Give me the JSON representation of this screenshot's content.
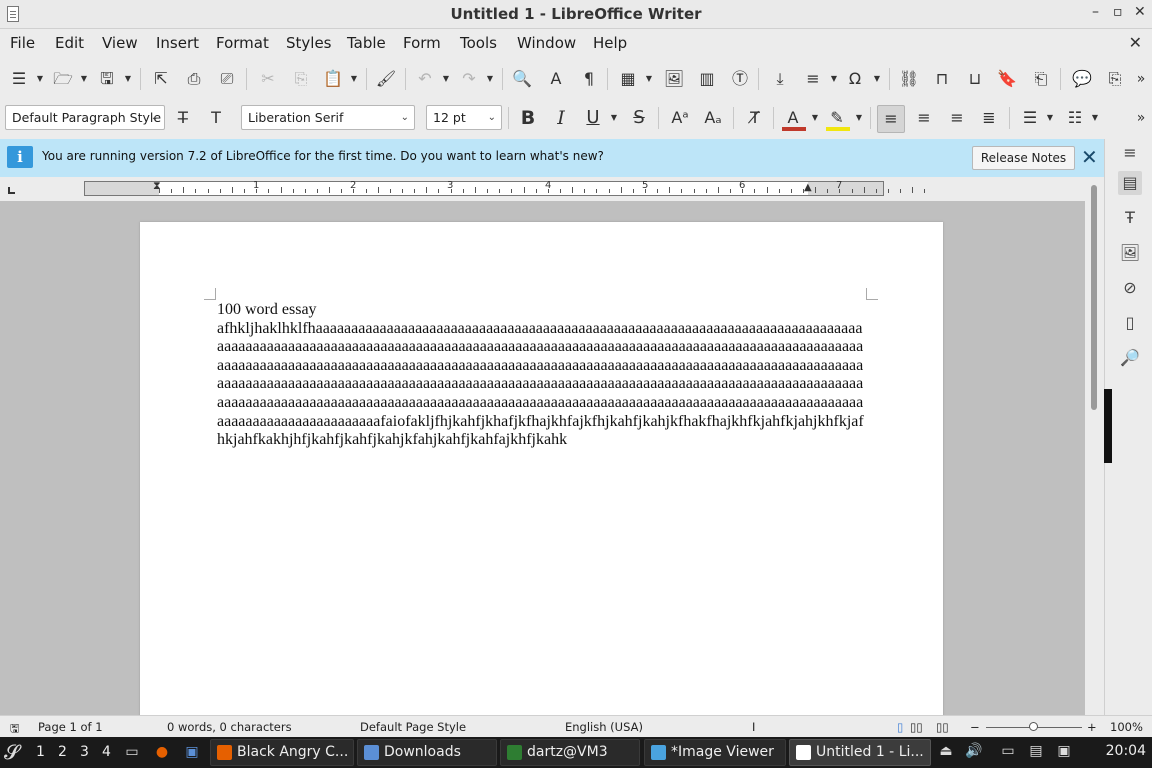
{
  "window": {
    "title": "Untitled 1 - LibreOffice Writer",
    "min_glyph": "–",
    "max_glyph": "▫",
    "close_glyph": "✕"
  },
  "menubar": {
    "items": [
      "File",
      "Edit",
      "View",
      "Insert",
      "Format",
      "Styles",
      "Table",
      "Form",
      "Tools",
      "Window",
      "Help"
    ],
    "close_glyph": "✕"
  },
  "formatting": {
    "paragraph_style": "Default Paragraph Style",
    "font_name": "Liberation Serif",
    "font_size": "12 pt",
    "bold_glyph": "B",
    "italic_glyph": "I",
    "underline_glyph": "U",
    "strike_glyph": "S",
    "font_color": "#c0392b",
    "highlight_color": "#f1e60f"
  },
  "infobar": {
    "message": "You are running version 7.2 of LibreOffice for the first time. Do you want to learn what's new?",
    "button_label": "Release Notes",
    "icon_glyph": "i",
    "close_glyph": "✕"
  },
  "ruler": {
    "numbers": [
      "1",
      "2",
      "3",
      "4",
      "5",
      "6",
      "7"
    ]
  },
  "document": {
    "line1": "100 word essay",
    "body": "afhkljhaklhklfhaaaaaaaaaaaaaaaaaaaaaaaaaaaaaaaaaaaaaaaaaaaaaaaaaaaaaaaaaaaaaaaaaaaaaaaaaaaaaaaaaaaaaaaaaaaaaaaaaaaaaaaaaaaaaaaaaaaaaaaaaaaaaaaaaaaaaaaaaaaaaaaaaaaaaaaaaaaaaaaaaaaaaaaaaaaaaaaaaaaaaaaaaaaaaaaaaaaaaaaaaaaaaaaaaaaaaaaaaaaaaaaaaaaaaaaaaaaaaaaaaaaaaaaaaaaaaaaaaaaaaaaaaaaaaaaaaaaaaaaaaaaaaaaaaaaaaaaaaaaaaaaaaaaaaaaaaaaaaaaaaaaaaaaaaaaaaaaaaaaaaaaaaaaaaaaaaaaaaaaaaaaaaaaaaaaaaaaaaaaaaaaaaaaaaaaaaaaaaaaaaaaaaaaaaaaaaaaaaaaaaaaaaaaaaaaaaaaaaaaaaaaaaaaaaaaaaaaaaaaaaaaafaiofakljfhjkahfjkhafjkfhajkhfajkfhjkahfjkahjkfhakfhajkhfkjahfkjahjkhfkjafhkjahfkakhjhfjkahfjkahfjkahjkfahjkahfjkahfajkhfjkahk"
  },
  "statusbar": {
    "page": "Page 1 of 1",
    "words": "0 words, 0 characters",
    "page_style": "Default Page Style",
    "language": "English (USA)",
    "zoom": "100%",
    "zoom_minus": "−",
    "zoom_plus": "+"
  },
  "taskbar": {
    "workspaces": [
      "1",
      "2",
      "3",
      "4"
    ],
    "tasks": [
      {
        "label": "Black Angry C...",
        "icon_color": "#e66000"
      },
      {
        "label": "Downloads",
        "icon_color": "#5b8fd6"
      },
      {
        "label": "dartz@VM3",
        "icon_color": "#2e7d32"
      },
      {
        "label": "*Image Viewer",
        "icon_color": "#4aa3df"
      },
      {
        "label": "Untitled 1 - Li...",
        "icon_color": "#ffffff"
      }
    ],
    "clock": "20:04"
  }
}
